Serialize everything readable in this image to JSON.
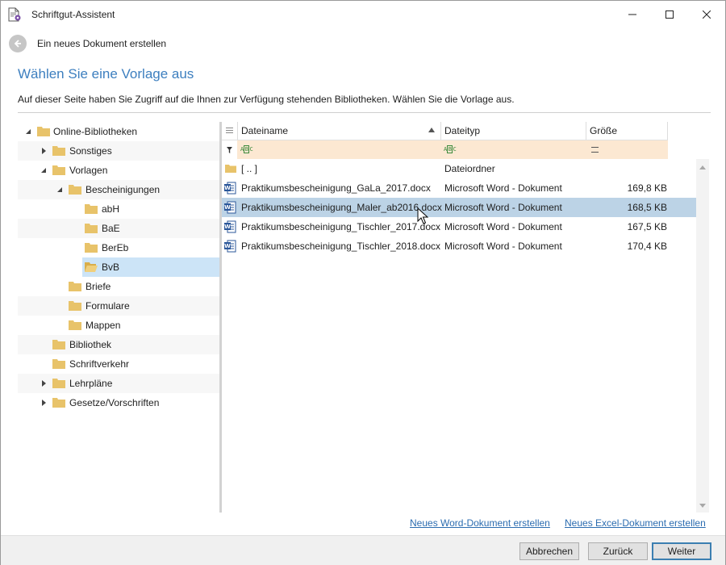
{
  "window": {
    "title": "Schriftgut-Assistent"
  },
  "wizard": {
    "step": "Ein neues Dokument erstellen",
    "title": "Wählen Sie eine Vorlage aus",
    "description": "Auf dieser Seite haben Sie Zugriff auf die Ihnen zur Verfügung stehenden Bibliotheken. Wählen Sie die Vorlage aus."
  },
  "tree": {
    "items": [
      {
        "label": "Online-Bibliotheken",
        "state": "expanded"
      },
      {
        "label": "Sonstiges",
        "state": "collapsed"
      },
      {
        "label": "Vorlagen",
        "state": "expanded"
      },
      {
        "label": "Bescheinigungen",
        "state": "expanded"
      },
      {
        "label": "abH",
        "state": "leaf"
      },
      {
        "label": "BaE",
        "state": "leaf"
      },
      {
        "label": "BerEb",
        "state": "leaf"
      },
      {
        "label": "BvB",
        "state": "leaf-selected"
      },
      {
        "label": "Briefe",
        "state": "leaf"
      },
      {
        "label": "Formulare",
        "state": "leaf"
      },
      {
        "label": "Mappen",
        "state": "leaf"
      },
      {
        "label": "Bibliothek",
        "state": "leaf"
      },
      {
        "label": "Schriftverkehr",
        "state": "leaf"
      },
      {
        "label": "Lehrpläne",
        "state": "collapsed"
      },
      {
        "label": "Gesetze/Vorschriften",
        "state": "collapsed"
      }
    ]
  },
  "grid": {
    "columns": {
      "name": "Dateiname",
      "type": "Dateityp",
      "size": "Größe"
    },
    "sort": {
      "column": "Dateiname",
      "direction": "ascending"
    },
    "rows": [
      {
        "name": "[ .. ]",
        "type": "Dateiordner",
        "size": "",
        "icon": "folder-icon"
      },
      {
        "name": "Praktikumsbescheinigung_GaLa_2017.docx",
        "type": "Microsoft Word - Dokument",
        "size": "169,8 KB",
        "icon": "word-doc-icon"
      },
      {
        "name": "Praktikumsbescheinigung_Maler_ab2016.docx",
        "type": "Microsoft Word - Dokument",
        "size": "168,5 KB",
        "icon": "word-doc-icon",
        "selected": true
      },
      {
        "name": "Praktikumsbescheinigung_Tischler_2017.docx",
        "type": "Microsoft Word - Dokument",
        "size": "167,5 KB",
        "icon": "word-doc-icon"
      },
      {
        "name": "Praktikumsbescheinigung_Tischler_2018.docx",
        "type": "Microsoft Word - Dokument",
        "size": "170,4 KB",
        "icon": "word-doc-icon"
      }
    ]
  },
  "links": {
    "new_word": "Neues Word-Dokument erstellen",
    "new_excel": "Neues Excel-Dokument erstellen"
  },
  "buttons": {
    "cancel": "Abbrechen",
    "back": "Zurück",
    "next": "Weiter"
  },
  "colors": {
    "accent": "#3d7fbf",
    "selection": "#bcd3e6",
    "tree_selection": "#cce4f7",
    "filter_row": "#fce8d2",
    "folder": "#e8c36a"
  }
}
